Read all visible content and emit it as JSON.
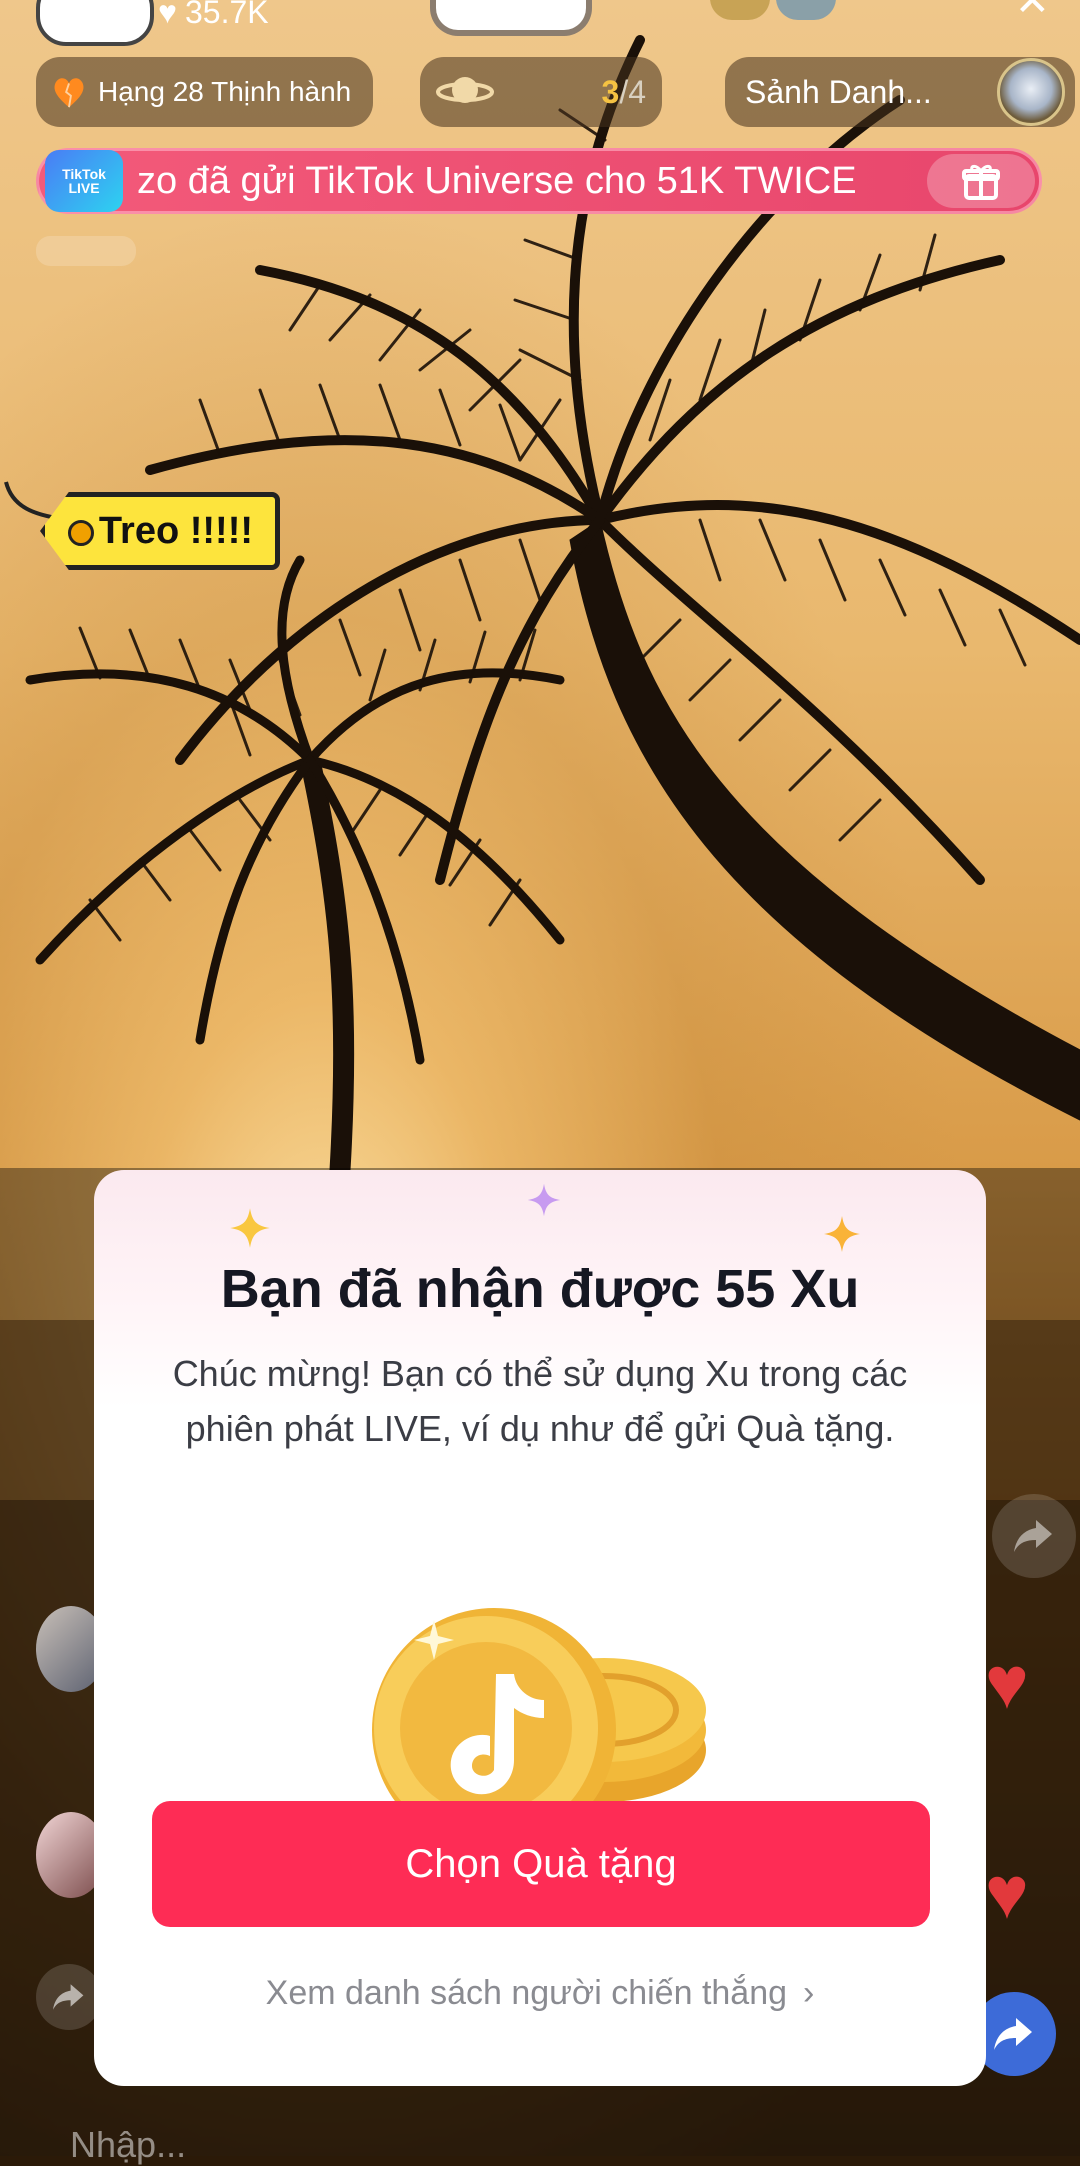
{
  "top": {
    "likes": "35.7K"
  },
  "ranking": {
    "label": "Hạng 28 Thịnh hành"
  },
  "mission": {
    "current": "3",
    "total": "/4"
  },
  "hall": {
    "label": "Sảnh Danh..."
  },
  "gift_banner": {
    "text": "zo đã gửi TikTok Universe cho 51K TWICE",
    "logo_text": "TikTok LIVE"
  },
  "sticker": {
    "text": "Treo !!!!!"
  },
  "modal": {
    "title": "Bạn đã nhận được 55 Xu",
    "description": "Chúc mừng! Bạn có thể sử dụng Xu trong các phiên phát LIVE, ví dụ như để gửi Quà tặng.",
    "primary_button": "Chọn Quà tặng",
    "winners_link": "Xem danh sách người chiến thắng"
  },
  "bottom": {
    "input_placeholder": "Nhập..."
  },
  "colors": {
    "primary": "#fe2c55",
    "banner": "#ef5274",
    "sticker": "#fde43d",
    "coin": "#f6c03a"
  }
}
